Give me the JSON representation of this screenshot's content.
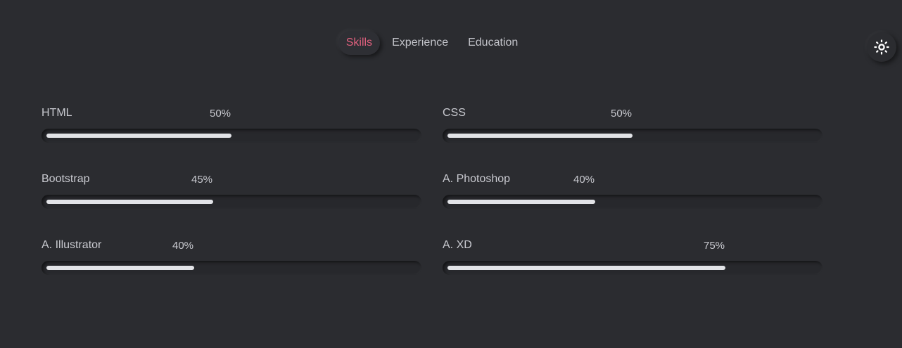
{
  "tabs": [
    {
      "label": "Skills",
      "active": true
    },
    {
      "label": "Experience",
      "active": false
    },
    {
      "label": "Education",
      "active": false
    }
  ],
  "theme_toggle": {
    "icon": "sun-icon"
  },
  "colors": {
    "background": "#2b2c30",
    "accent": "#e0607e",
    "bar_fill": "#e2e3e7"
  },
  "skills": [
    {
      "name": "HTML",
      "percent_label": "50%",
      "value": 50
    },
    {
      "name": "CSS",
      "percent_label": "50%",
      "value": 50
    },
    {
      "name": "Bootstrap",
      "percent_label": "45%",
      "value": 45
    },
    {
      "name": "A. Photoshop",
      "percent_label": "40%",
      "value": 40
    },
    {
      "name": "A. Illustrator",
      "percent_label": "40%",
      "value": 40
    },
    {
      "name": "A. XD",
      "percent_label": "75%",
      "value": 75
    }
  ]
}
